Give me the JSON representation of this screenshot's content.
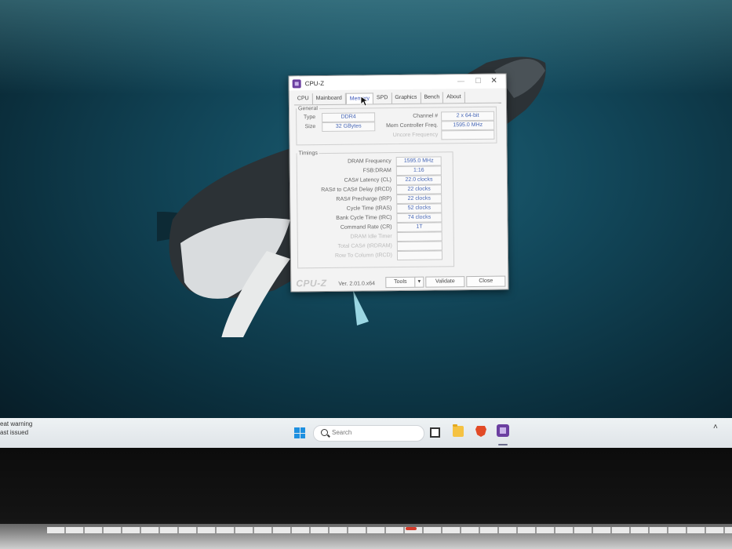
{
  "window": {
    "title": "CPU-Z",
    "tabs": [
      "CPU",
      "Mainboard",
      "Memory",
      "SPD",
      "Graphics",
      "Bench",
      "About"
    ],
    "active_tab": "Memory"
  },
  "general": {
    "legend": "General",
    "type_label": "Type",
    "type_value": "DDR4",
    "size_label": "Size",
    "size_value": "32 GBytes",
    "channel_label": "Channel #",
    "channel_value": "2 x 64-bit",
    "mem_ctrl_label": "Mem Controller Freq.",
    "mem_ctrl_value": "1595.0 MHz",
    "uncore_label": "Uncore Frequency",
    "uncore_value": ""
  },
  "timings": {
    "legend": "Timings",
    "rows": [
      {
        "label": "DRAM Frequency",
        "value": "1595.0 MHz"
      },
      {
        "label": "FSB:DRAM",
        "value": "1:16"
      },
      {
        "label": "CAS# Latency (CL)",
        "value": "22.0 clocks"
      },
      {
        "label": "RAS# to CAS# Delay (tRCD)",
        "value": "22 clocks"
      },
      {
        "label": "RAS# Precharge (tRP)",
        "value": "22 clocks"
      },
      {
        "label": "Cycle Time (tRAS)",
        "value": "52 clocks"
      },
      {
        "label": "Bank Cycle Time (tRC)",
        "value": "74 clocks"
      },
      {
        "label": "Command Rate (CR)",
        "value": "1T"
      },
      {
        "label": "DRAM Idle Timer",
        "value": ""
      },
      {
        "label": "Total CAS# (tRDRAM)",
        "value": ""
      },
      {
        "label": "Row To Column (tRCD)",
        "value": ""
      }
    ]
  },
  "footer": {
    "logo": "CPU-Z",
    "version": "Ver. 2.01.0.x64",
    "tools_label": "Tools",
    "validate_label": "Validate",
    "close_label": "Close"
  },
  "taskbar": {
    "notification_line1": "eat warning",
    "notification_line2": "ast issued",
    "search_placeholder": "Search",
    "icons": [
      "windows-start-icon",
      "search-icon",
      "task-view-icon",
      "file-explorer-icon",
      "brave-browser-icon",
      "cpuz-taskbar-icon",
      "chevron-up-icon"
    ]
  },
  "colors": {
    "accent_text": "#4666b6",
    "app_icon": "#6b3fa0",
    "wallpaper": "#12475a"
  }
}
